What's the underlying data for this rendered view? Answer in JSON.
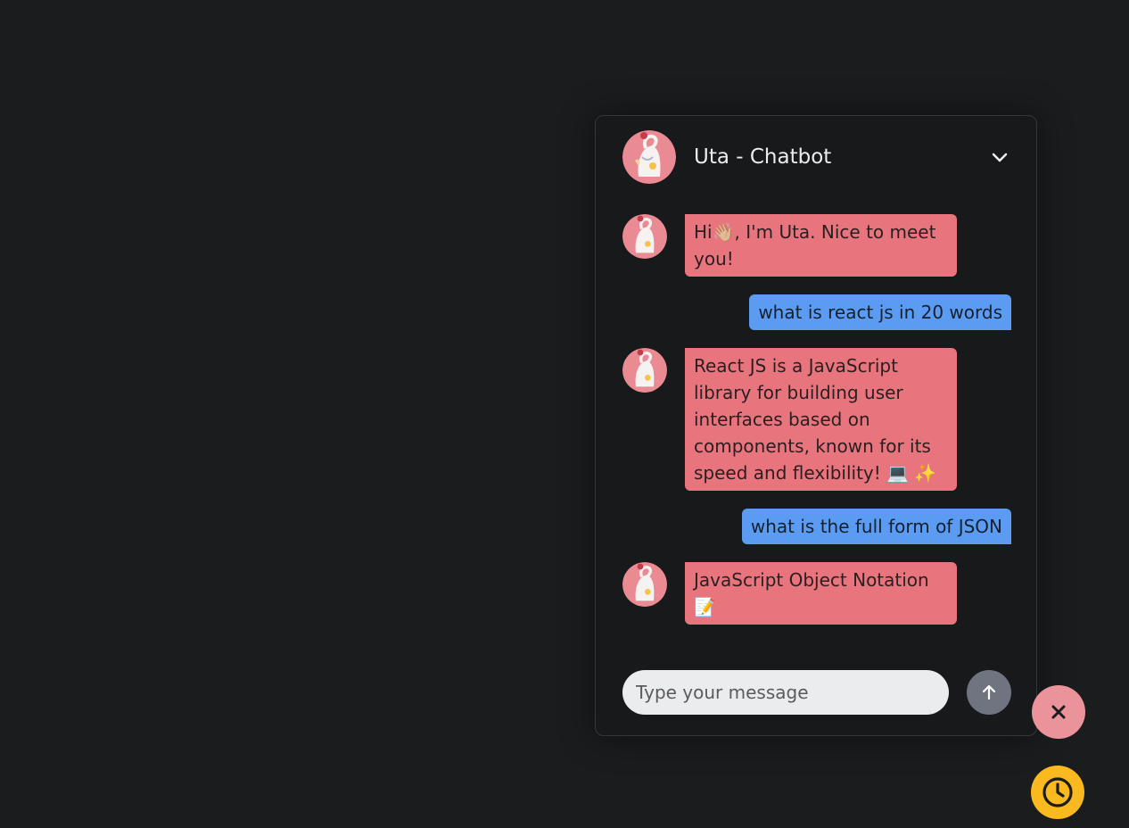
{
  "header": {
    "title": "Uta - Chatbot",
    "collapse_icon": "chevron-down-icon"
  },
  "messages": [
    {
      "role": "bot",
      "text": "Hi👋🏼, I'm Uta. Nice to meet you!"
    },
    {
      "role": "user",
      "text": "what is react js in 20 words"
    },
    {
      "role": "bot",
      "text": "React JS is a JavaScript library for building user interfaces based on components, known for its speed and flexibility! 💻 ✨"
    },
    {
      "role": "user",
      "text": "what is the full form of JSON"
    },
    {
      "role": "bot",
      "text": "JavaScript Object Notation 📝"
    }
  ],
  "composer": {
    "placeholder": "Type your message",
    "send_icon": "arrow-up-icon"
  },
  "fabs": {
    "close_icon": "close-icon",
    "history_icon": "clock-icon"
  },
  "colors": {
    "background": "#1b1c1e",
    "bot_bubble": "#e8757d",
    "user_bubble": "#5b9cf2",
    "send_button": "#6f7480",
    "close_fab": "#eb939b",
    "history_fab": "#f9b91f"
  }
}
